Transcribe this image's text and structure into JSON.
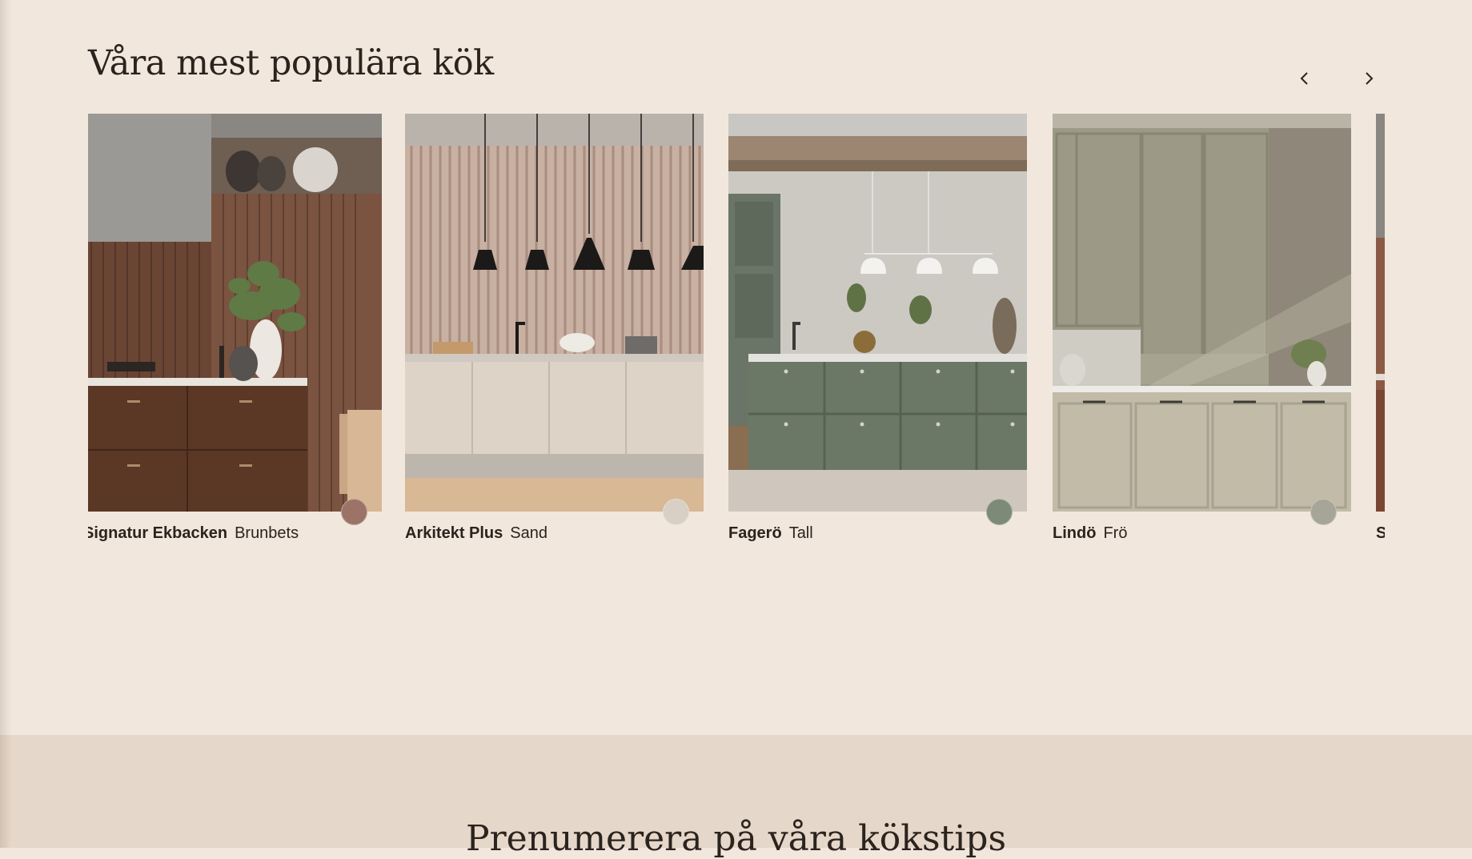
{
  "popular": {
    "title": "Våra mest populära kök",
    "nav": {
      "prev_icon": "chevron-left-icon",
      "next_icon": "chevron-right-icon"
    },
    "kitchens": [
      {
        "model": "Signatur Ekbacken",
        "variant": "Brunbets",
        "swatch_color": "#9b7467"
      },
      {
        "model": "Arkitekt Plus",
        "variant": "Sand",
        "swatch_color": "#d8cfc5"
      },
      {
        "model": "Fagerö",
        "variant": "Tall",
        "swatch_color": "#7c8a77"
      },
      {
        "model": "Lindö",
        "variant": "Frö",
        "swatch_color": "#a6a597"
      },
      {
        "model": "S",
        "variant": "",
        "swatch_color": "#8b5a44"
      }
    ]
  },
  "subscribe": {
    "title": "Prenumerera på våra kökstips"
  }
}
